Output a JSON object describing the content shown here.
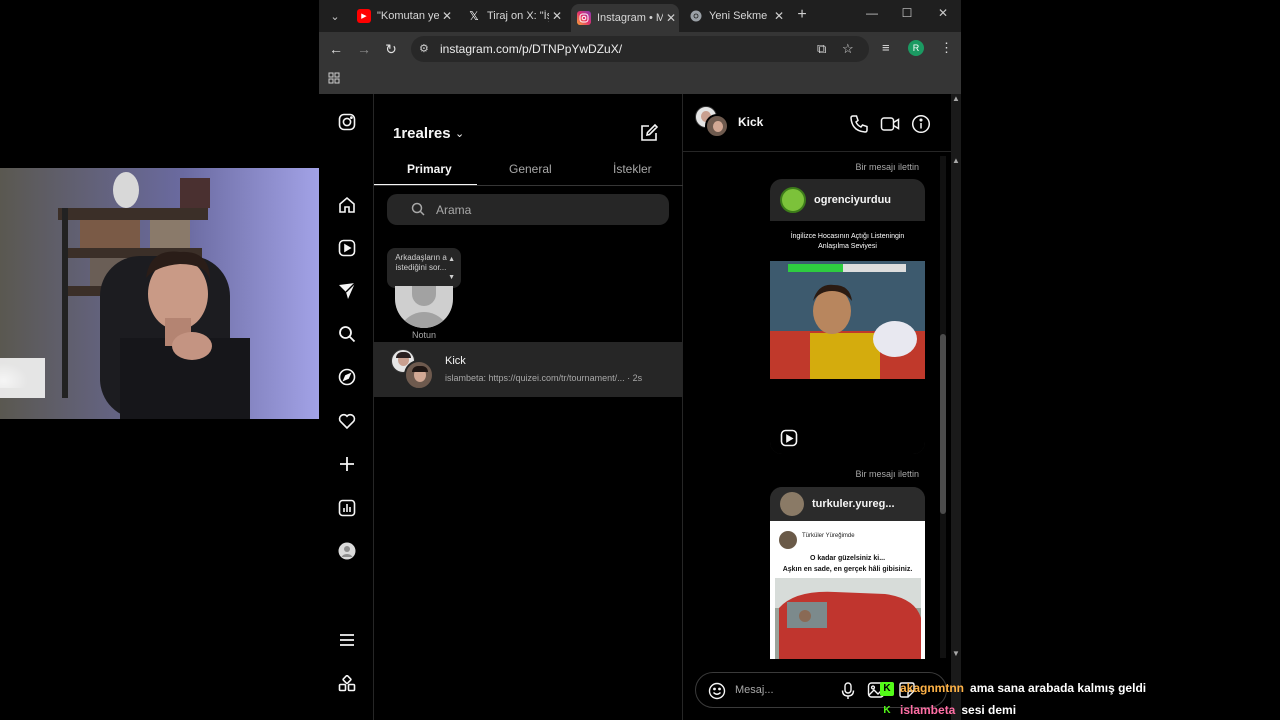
{
  "browser": {
    "tabs": [
      {
        "title": "\"Komutan yer",
        "favicon": "youtube-icon"
      },
      {
        "title": "Tiraj on X: \"İş",
        "favicon": "x-icon"
      },
      {
        "title": "Instagram • M",
        "favicon": "instagram-icon",
        "active": true
      },
      {
        "title": "Yeni Sekme",
        "favicon": "chrome-icon"
      }
    ],
    "url": "instagram.com/p/DTNPpYwDZuX/",
    "profile_initial": "R"
  },
  "instagram": {
    "username": "1realres",
    "tabs": [
      {
        "label": "Primary",
        "active": true
      },
      {
        "label": "General"
      },
      {
        "label": "İstekler"
      }
    ],
    "search_placeholder": "Arama",
    "note": {
      "text": "Arkadaşların a istediğini sor...",
      "label": "Notun"
    },
    "conversations": [
      {
        "name": "Kick",
        "preview": "islambeta: https://quizei.com/tr/tournament/... · 2s"
      }
    ],
    "thread": {
      "name": "Kick",
      "messages": [
        {
          "forward_label": "Bir mesajı ilettin",
          "account": "ogrenciyurduu",
          "caption_line1": "İngilizce Hocasının Açtığı Listeningin",
          "caption_line2": "Anlaşılma Seviyesi"
        },
        {
          "forward_label": "Bir mesajı ilettin",
          "account": "turkuler.yureg...",
          "tweet_author": "Türküler Yüreğimde",
          "tweet_line1": "O kadar güzelsiniz ki...",
          "tweet_line2": "Aşkın en sade, en gerçek hâli gibisiniz."
        }
      ],
      "message_placeholder": "Mesaj..."
    }
  },
  "stream_chat": [
    {
      "user": "akagnmtnn",
      "message": "ama sana arabada kalmış geldi"
    },
    {
      "user": "islambeta",
      "message": "sesi demi"
    }
  ],
  "colors": {
    "kick_green": "#53fc18",
    "instagram_bg": "#000000",
    "tab_bar": "#1f1f1f"
  }
}
